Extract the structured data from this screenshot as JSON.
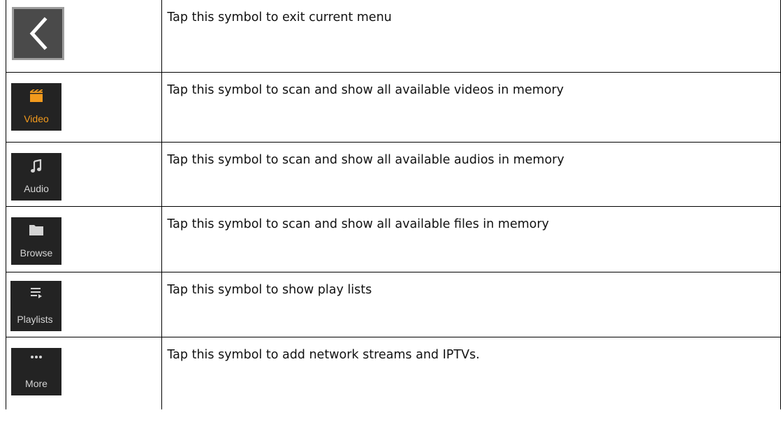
{
  "colors": {
    "accent": "#f29a1d",
    "tile_background": "#232323",
    "tile_label": "#d4d4d4",
    "back_button_background": "#4a4a4a"
  },
  "rows": [
    {
      "icon": "back-chevron-icon",
      "description": "Tap this symbol to exit current menu"
    },
    {
      "icon": "clapperboard-icon",
      "label": "Video",
      "description": "Tap this symbol to scan and show all available videos in memory"
    },
    {
      "icon": "music-note-icon",
      "label": "Audio",
      "description": "Tap this symbol to scan and show all available audios in memory"
    },
    {
      "icon": "folder-icon",
      "label": "Browse",
      "description": "Tap this symbol to scan and show all available files in memory"
    },
    {
      "icon": "playlist-icon",
      "label": "Playlists",
      "description": "Tap this symbol to show play lists"
    },
    {
      "icon": "more-dots-icon",
      "label": "More",
      "description": "Tap this symbol to add network streams and IPTVs."
    }
  ]
}
